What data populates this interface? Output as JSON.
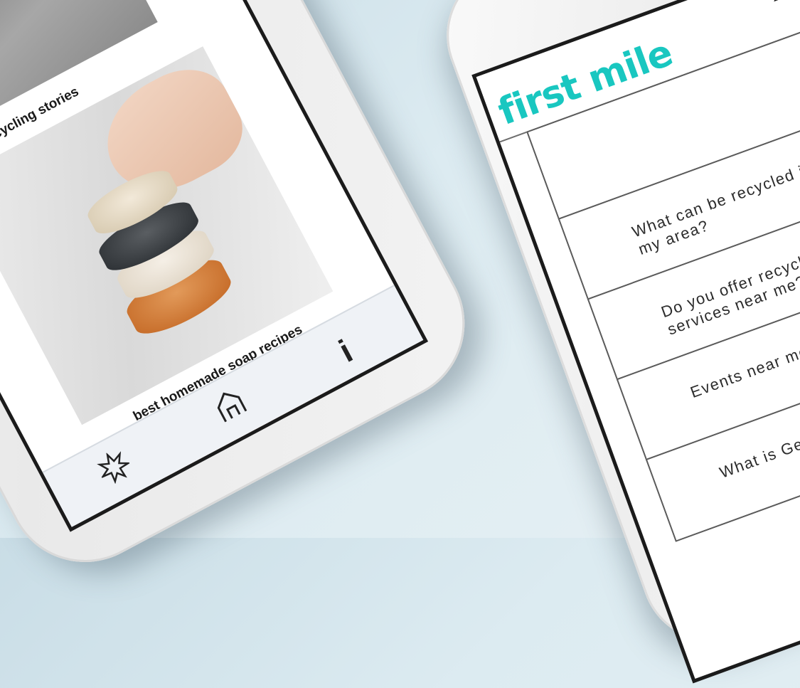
{
  "left_phone": {
    "stories": [
      {
        "title": "first mile recycling stories"
      },
      {
        "title": "best homemade soap recipes"
      }
    ],
    "nav": {
      "icons": [
        "starburst-icon",
        "home-icon",
        "info-icon"
      ],
      "info_glyph": "i"
    }
  },
  "right_phone": {
    "brand": "first mile",
    "header_icons": [
      "user-icon",
      "basket-icon"
    ],
    "brand_color": "#19c7c0",
    "questions": [
      {
        "label": "What can be recycled in my area?"
      },
      {
        "label": "Do you offer recycling services near me?"
      },
      {
        "label": "Events near me?"
      },
      {
        "label": "What is General Wa"
      }
    ]
  }
}
